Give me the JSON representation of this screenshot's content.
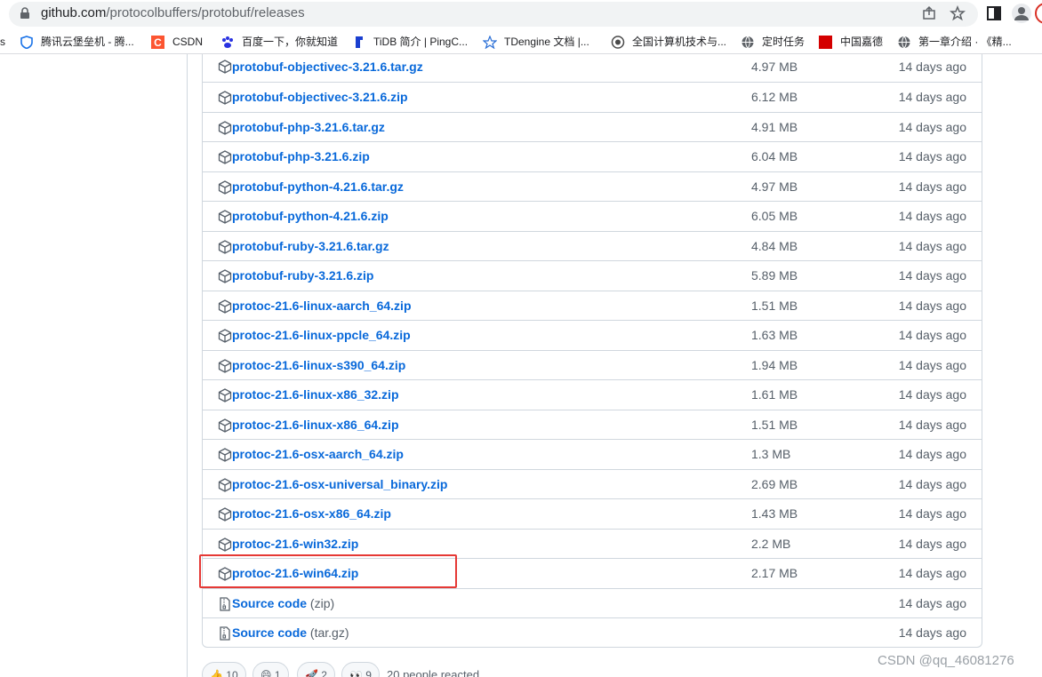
{
  "browser": {
    "url_host": "github.com",
    "url_path": "/protocolbuffers/protobuf/releases"
  },
  "bookmarks": [
    {
      "label": "s"
    },
    {
      "label": "腾讯云堡垒机 - 腾..."
    },
    {
      "label": "CSDN"
    },
    {
      "label": "百度一下，你就知道"
    },
    {
      "label": "TiDB 简介 | PingC..."
    },
    {
      "label": "TDengine 文档 |..."
    },
    {
      "label": "全国计算机技术与..."
    },
    {
      "label": "定时任务"
    },
    {
      "label": "中国嘉德"
    },
    {
      "label": "第一章介绍 · 《精..."
    }
  ],
  "assets": [
    {
      "name": "protobuf-objectivec-3.21.6.tar.gz",
      "size": "4.97 MB",
      "time": "14 days ago"
    },
    {
      "name": "protobuf-objectivec-3.21.6.zip",
      "size": "6.12 MB",
      "time": "14 days ago"
    },
    {
      "name": "protobuf-php-3.21.6.tar.gz",
      "size": "4.91 MB",
      "time": "14 days ago"
    },
    {
      "name": "protobuf-php-3.21.6.zip",
      "size": "6.04 MB",
      "time": "14 days ago"
    },
    {
      "name": "protobuf-python-4.21.6.tar.gz",
      "size": "4.97 MB",
      "time": "14 days ago"
    },
    {
      "name": "protobuf-python-4.21.6.zip",
      "size": "6.05 MB",
      "time": "14 days ago"
    },
    {
      "name": "protobuf-ruby-3.21.6.tar.gz",
      "size": "4.84 MB",
      "time": "14 days ago"
    },
    {
      "name": "protobuf-ruby-3.21.6.zip",
      "size": "5.89 MB",
      "time": "14 days ago"
    },
    {
      "name": "protoc-21.6-linux-aarch_64.zip",
      "size": "1.51 MB",
      "time": "14 days ago"
    },
    {
      "name": "protoc-21.6-linux-ppcle_64.zip",
      "size": "1.63 MB",
      "time": "14 days ago"
    },
    {
      "name": "protoc-21.6-linux-s390_64.zip",
      "size": "1.94 MB",
      "time": "14 days ago"
    },
    {
      "name": "protoc-21.6-linux-x86_32.zip",
      "size": "1.61 MB",
      "time": "14 days ago"
    },
    {
      "name": "protoc-21.6-linux-x86_64.zip",
      "size": "1.51 MB",
      "time": "14 days ago"
    },
    {
      "name": "protoc-21.6-osx-aarch_64.zip",
      "size": "1.3 MB",
      "time": "14 days ago"
    },
    {
      "name": "protoc-21.6-osx-universal_binary.zip",
      "size": "2.69 MB",
      "time": "14 days ago"
    },
    {
      "name": "protoc-21.6-osx-x86_64.zip",
      "size": "1.43 MB",
      "time": "14 days ago"
    },
    {
      "name": "protoc-21.6-win32.zip",
      "size": "2.2 MB",
      "time": "14 days ago"
    },
    {
      "name": "protoc-21.6-win64.zip",
      "size": "2.17 MB",
      "time": "14 days ago"
    }
  ],
  "source_code": [
    {
      "name": "Source code",
      "ext": "(zip)",
      "time": "14 days ago"
    },
    {
      "name": "Source code",
      "ext": "(tar.gz)",
      "time": "14 days ago"
    }
  ],
  "reactions": {
    "items": [
      {
        "icon": "thumbs-up-icon",
        "count": "10"
      },
      {
        "icon": "smile-icon",
        "count": "1"
      },
      {
        "icon": "rocket-icon",
        "count": "2"
      },
      {
        "icon": "eyes-icon",
        "count": "9"
      }
    ],
    "summary": "20 people reacted"
  },
  "watermark": "CSDN @qq_46081276",
  "colors": {
    "link": "#0969da",
    "muted": "#57606a",
    "border": "#d0d7de",
    "highlight": "#e53935"
  }
}
